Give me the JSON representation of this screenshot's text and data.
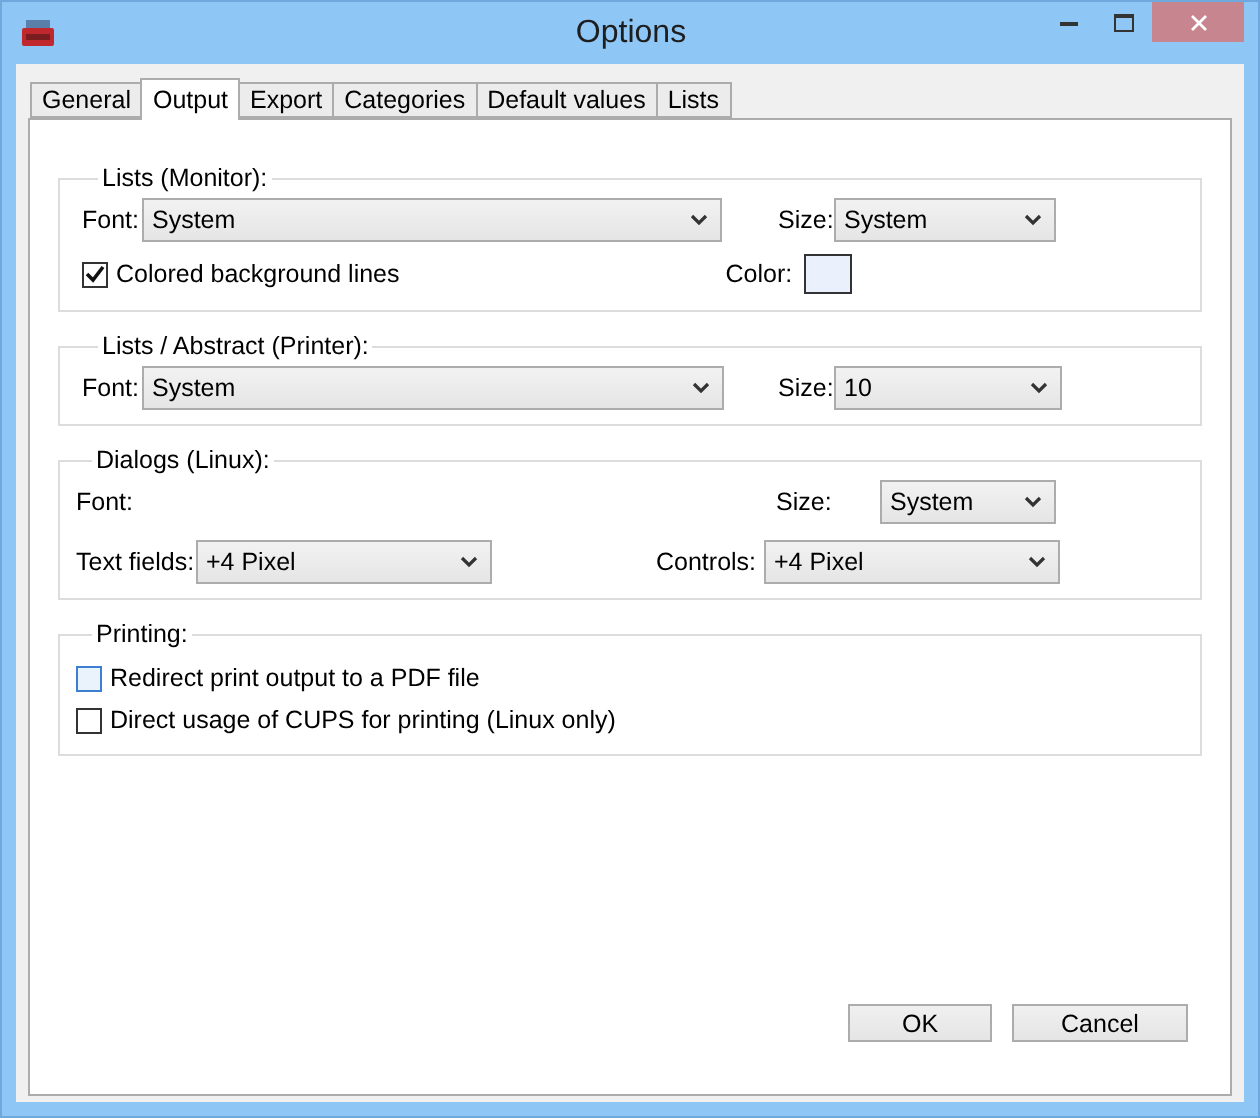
{
  "window": {
    "title": "Options"
  },
  "tabs": [
    {
      "label": "General",
      "selected": false
    },
    {
      "label": "Output",
      "selected": true
    },
    {
      "label": "Export",
      "selected": false
    },
    {
      "label": "Categories",
      "selected": false
    },
    {
      "label": "Default values",
      "selected": false
    },
    {
      "label": "Lists",
      "selected": false
    }
  ],
  "lists_monitor": {
    "title": "Lists (Monitor):",
    "font": {
      "label": "Font:",
      "value": "System"
    },
    "size": {
      "label": "Size:",
      "value": "System"
    },
    "colored_lines": {
      "label": "Colored background lines",
      "checked": true
    },
    "color": {
      "label": "Color:",
      "color": "#eaf0fc"
    }
  },
  "lists_printer": {
    "title": "Lists / Abstract (Printer):",
    "font": {
      "label": "Font:",
      "value": "System"
    },
    "size": {
      "label": "Size:",
      "value": "10"
    }
  },
  "dialogs": {
    "title": "Dialogs (Linux):",
    "font": {
      "label": "Font:"
    },
    "size": {
      "label": "Size:",
      "value": "System"
    },
    "text_fields": {
      "label": "Text fields:",
      "value": "+4 Pixel"
    },
    "controls": {
      "label": "Controls:",
      "value": "+4 Pixel"
    }
  },
  "printing": {
    "title": "Printing:",
    "options": [
      {
        "label": "Redirect print output to a PDF file",
        "checked": false,
        "hovered": true
      },
      {
        "label": "Direct usage of CUPS for printing (Linux only)",
        "checked": false,
        "hovered": false
      }
    ]
  },
  "buttons": [
    {
      "label": "OK"
    },
    {
      "label": "Cancel"
    }
  ]
}
